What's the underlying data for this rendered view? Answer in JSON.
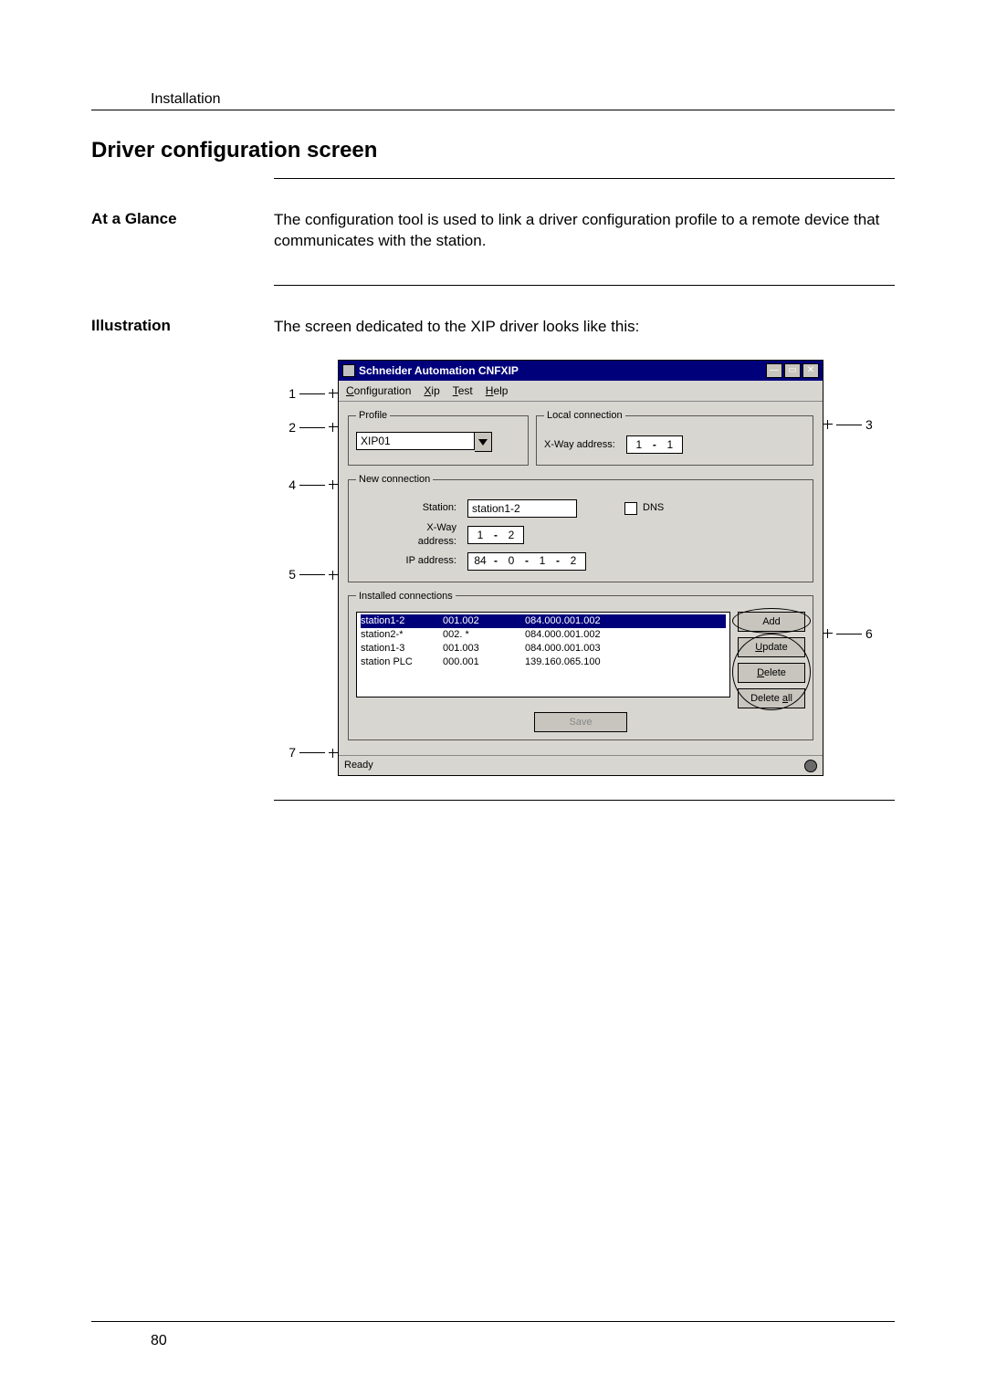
{
  "running_head": "Installation",
  "section_title": "Driver configuration screen",
  "at_a_glance": {
    "label": "At a Glance",
    "text": "The configuration tool is used to link a driver configuration profile to a remote device that communicates with the station."
  },
  "illustration": {
    "label": "Illustration",
    "lead_in": "The screen dedicated to the XIP driver looks like this:"
  },
  "callouts": {
    "c1": "1",
    "c2": "2",
    "c3": "3",
    "c4": "4",
    "c5": "5",
    "c6": "6",
    "c7": "7"
  },
  "app": {
    "title": "Schneider Automation CNFXIP",
    "menu": {
      "config": "Configuration",
      "xip": "Xip",
      "test": "Test",
      "help": "Help"
    },
    "profile_legend": "Profile",
    "profile_value": "XIP01",
    "local_legend": "Local connection",
    "xway_label": "X-Way address:",
    "local_xway_a": "1",
    "local_xway_b": "1",
    "new_legend": "New connection",
    "station_label": "Station:",
    "station_value": "station1-2",
    "dns_label": "DNS",
    "new_xway_a": "1",
    "new_xway_b": "2",
    "ip_label": "IP address:",
    "ip_a": "84",
    "ip_b": "0",
    "ip_c": "1",
    "ip_d": "2",
    "installed_legend": "Installed connections",
    "rows": [
      {
        "name": "station1-2",
        "xway": "001.002",
        "ip": "084.000.001.002"
      },
      {
        "name": "station2-*",
        "xway": "002. *",
        "ip": "084.000.001.002"
      },
      {
        "name": "station1-3",
        "xway": "001.003",
        "ip": "084.000.001.003"
      },
      {
        "name": "station PLC",
        "xway": "000.001",
        "ip": "139.160.065.100"
      }
    ],
    "btn_add": "Add",
    "btn_update": "Update",
    "btn_delete": "Delete",
    "btn_delete_all": "Delete all",
    "btn_save": "Save",
    "status": "Ready"
  },
  "page_number": "80"
}
